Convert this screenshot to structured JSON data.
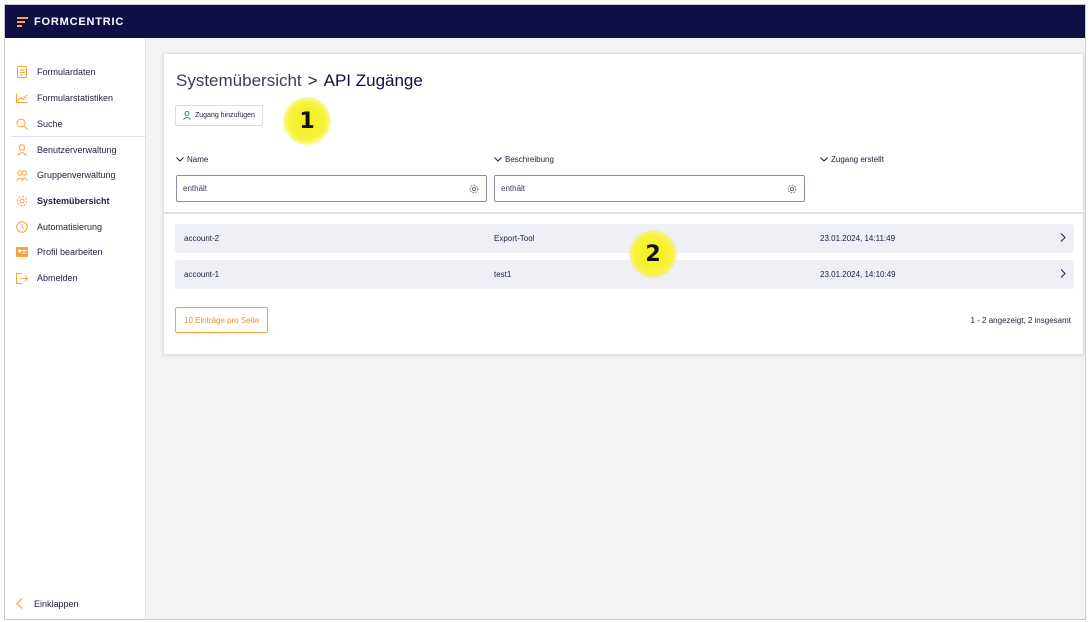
{
  "app": {
    "logo_text": "FORMCENTRIC",
    "brand_color": "#0f0f46",
    "accent_color": "#f7a23a"
  },
  "sidebar": {
    "items": [
      {
        "label": "Formulardaten",
        "icon": "document-icon"
      },
      {
        "label": "Formularstatistiken",
        "icon": "line-chart-icon"
      },
      {
        "label": "Suche",
        "icon": "search-icon"
      },
      {
        "label": "Benutzerverwaltung",
        "icon": "user-icon"
      },
      {
        "label": "Gruppenverwaltung",
        "icon": "group-icon"
      },
      {
        "label": "Systemübersicht",
        "icon": "gear-icon",
        "active": true
      },
      {
        "label": "Automatisierung",
        "icon": "clock-icon"
      },
      {
        "label": "Profil bearbeiten",
        "icon": "id-card-icon"
      },
      {
        "label": "Abmelden",
        "icon": "logout-icon"
      }
    ],
    "collapse_label": "Einklappen"
  },
  "breadcrumb": {
    "parent": "Systemübersicht",
    "separator": ">",
    "current": "API Zugänge"
  },
  "toolbar": {
    "add_label": "Zugang hinzufügen"
  },
  "table": {
    "columns": [
      {
        "label": "Name",
        "filter_placeholder": "enthält"
      },
      {
        "label": "Beschreibung",
        "filter_placeholder": "enthält"
      },
      {
        "label": "Zugang erstellt"
      }
    ],
    "rows": [
      {
        "name": "account-2",
        "description": "Export-Tool",
        "created": "23.01.2024, 14:11:49"
      },
      {
        "name": "account-1",
        "description": "test1",
        "created": "23.01.2024, 14:10:49"
      }
    ]
  },
  "pagination": {
    "per_page_label": "10 Einträge pro Seite",
    "info": "1 - 2 angezeigt, 2 insgesamt"
  },
  "annotations": [
    {
      "label": "1"
    },
    {
      "label": "2"
    }
  ]
}
